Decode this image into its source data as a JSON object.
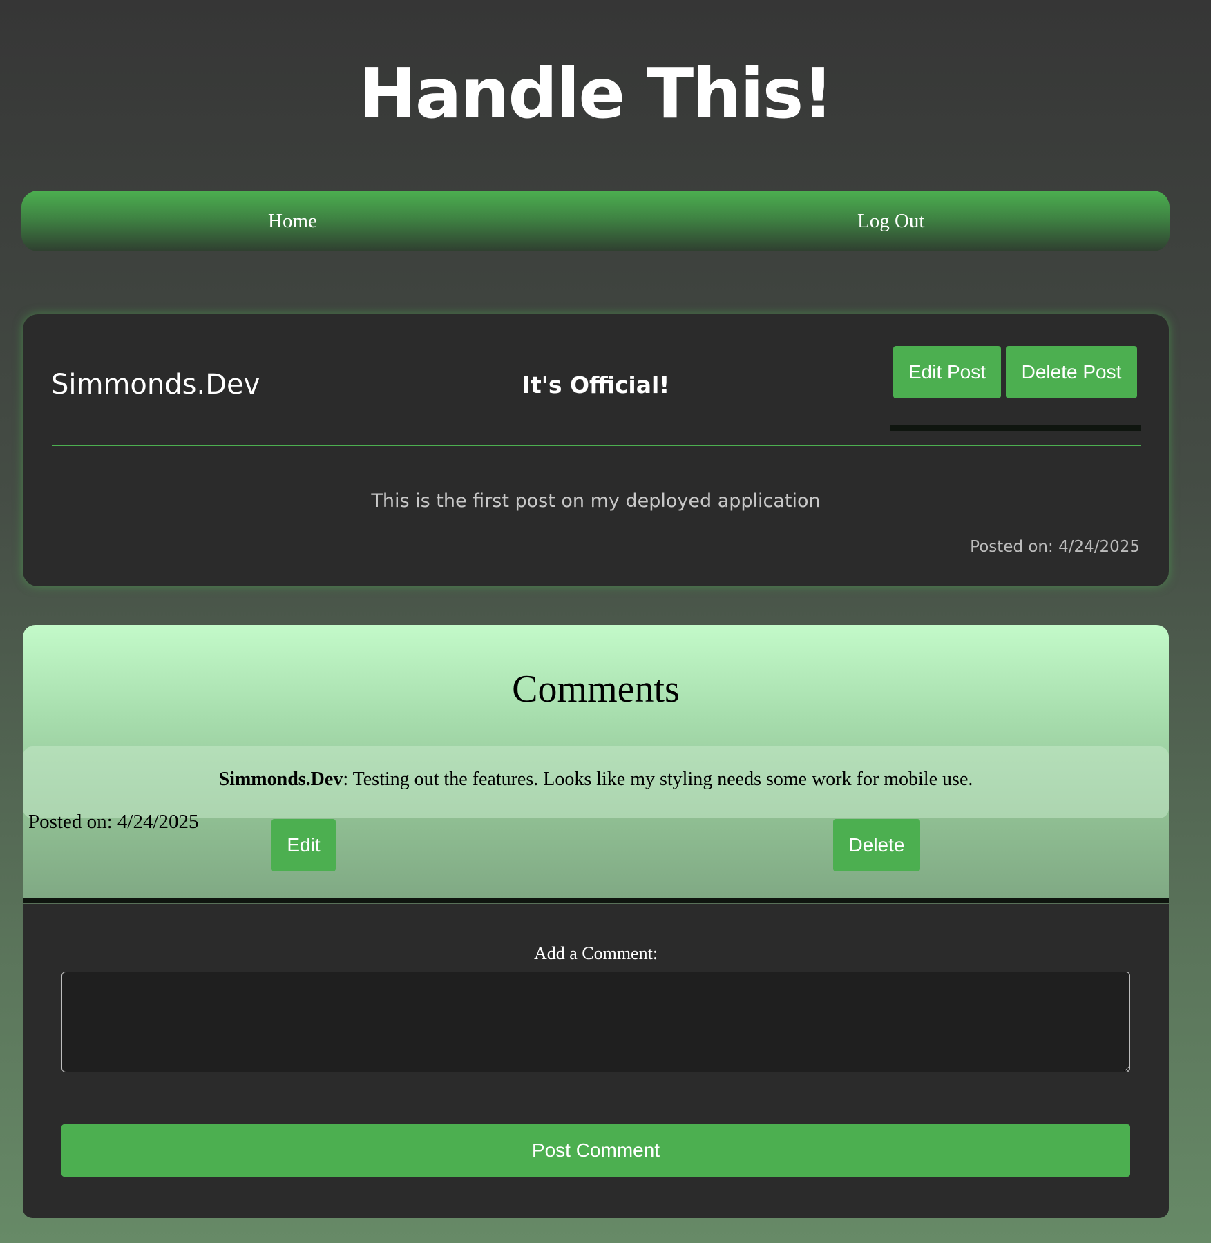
{
  "header": {
    "title": "Handle This!"
  },
  "nav": {
    "home_label": "Home",
    "logout_label": "Log Out"
  },
  "post": {
    "author": "Simmonds.Dev",
    "title": "It's Official!",
    "edit_label": "Edit Post",
    "delete_label": "Delete Post",
    "body": "This is the first post on my deployed application",
    "date": "Posted on: 4/24/2025"
  },
  "comments": {
    "heading": "Comments",
    "items": [
      {
        "author": "Simmonds.Dev",
        "text": ": Testing out the features. Looks like my styling needs some work for mobile use.",
        "date": "Posted on: 4/24/2025",
        "edit_label": "Edit",
        "delete_label": "Delete"
      }
    ]
  },
  "comment_form": {
    "label": "Add a Comment:",
    "value": "",
    "submit_label": "Post Comment"
  },
  "colors": {
    "accent": "#4caf50",
    "card_bg": "#2b2b2b",
    "comments_bg_top": "#c3fac9"
  }
}
